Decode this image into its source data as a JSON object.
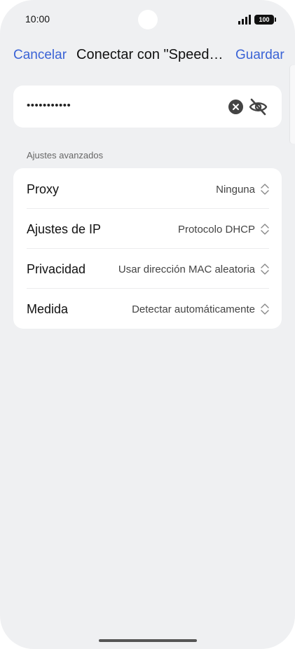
{
  "status_bar": {
    "time": "10:00",
    "battery": "100"
  },
  "header": {
    "cancel_label": "Cancelar",
    "title": "Conectar con \"SpeedTestNetwork\"",
    "save_label": "Guardar"
  },
  "password": {
    "value": "•••••••••••"
  },
  "advanced": {
    "section_label": "Ajustes avanzados",
    "rows": [
      {
        "label": "Proxy",
        "value": "Ninguna"
      },
      {
        "label": "Ajustes de IP",
        "value": "Protocolo DHCP"
      },
      {
        "label": "Privacidad",
        "value": "Usar dirección MAC aleatoria"
      },
      {
        "label": "Medida",
        "value": "Detectar automáticamente"
      }
    ]
  },
  "colors": {
    "accent": "#3a63d6",
    "background": "#eff0f2",
    "card": "#ffffff"
  }
}
